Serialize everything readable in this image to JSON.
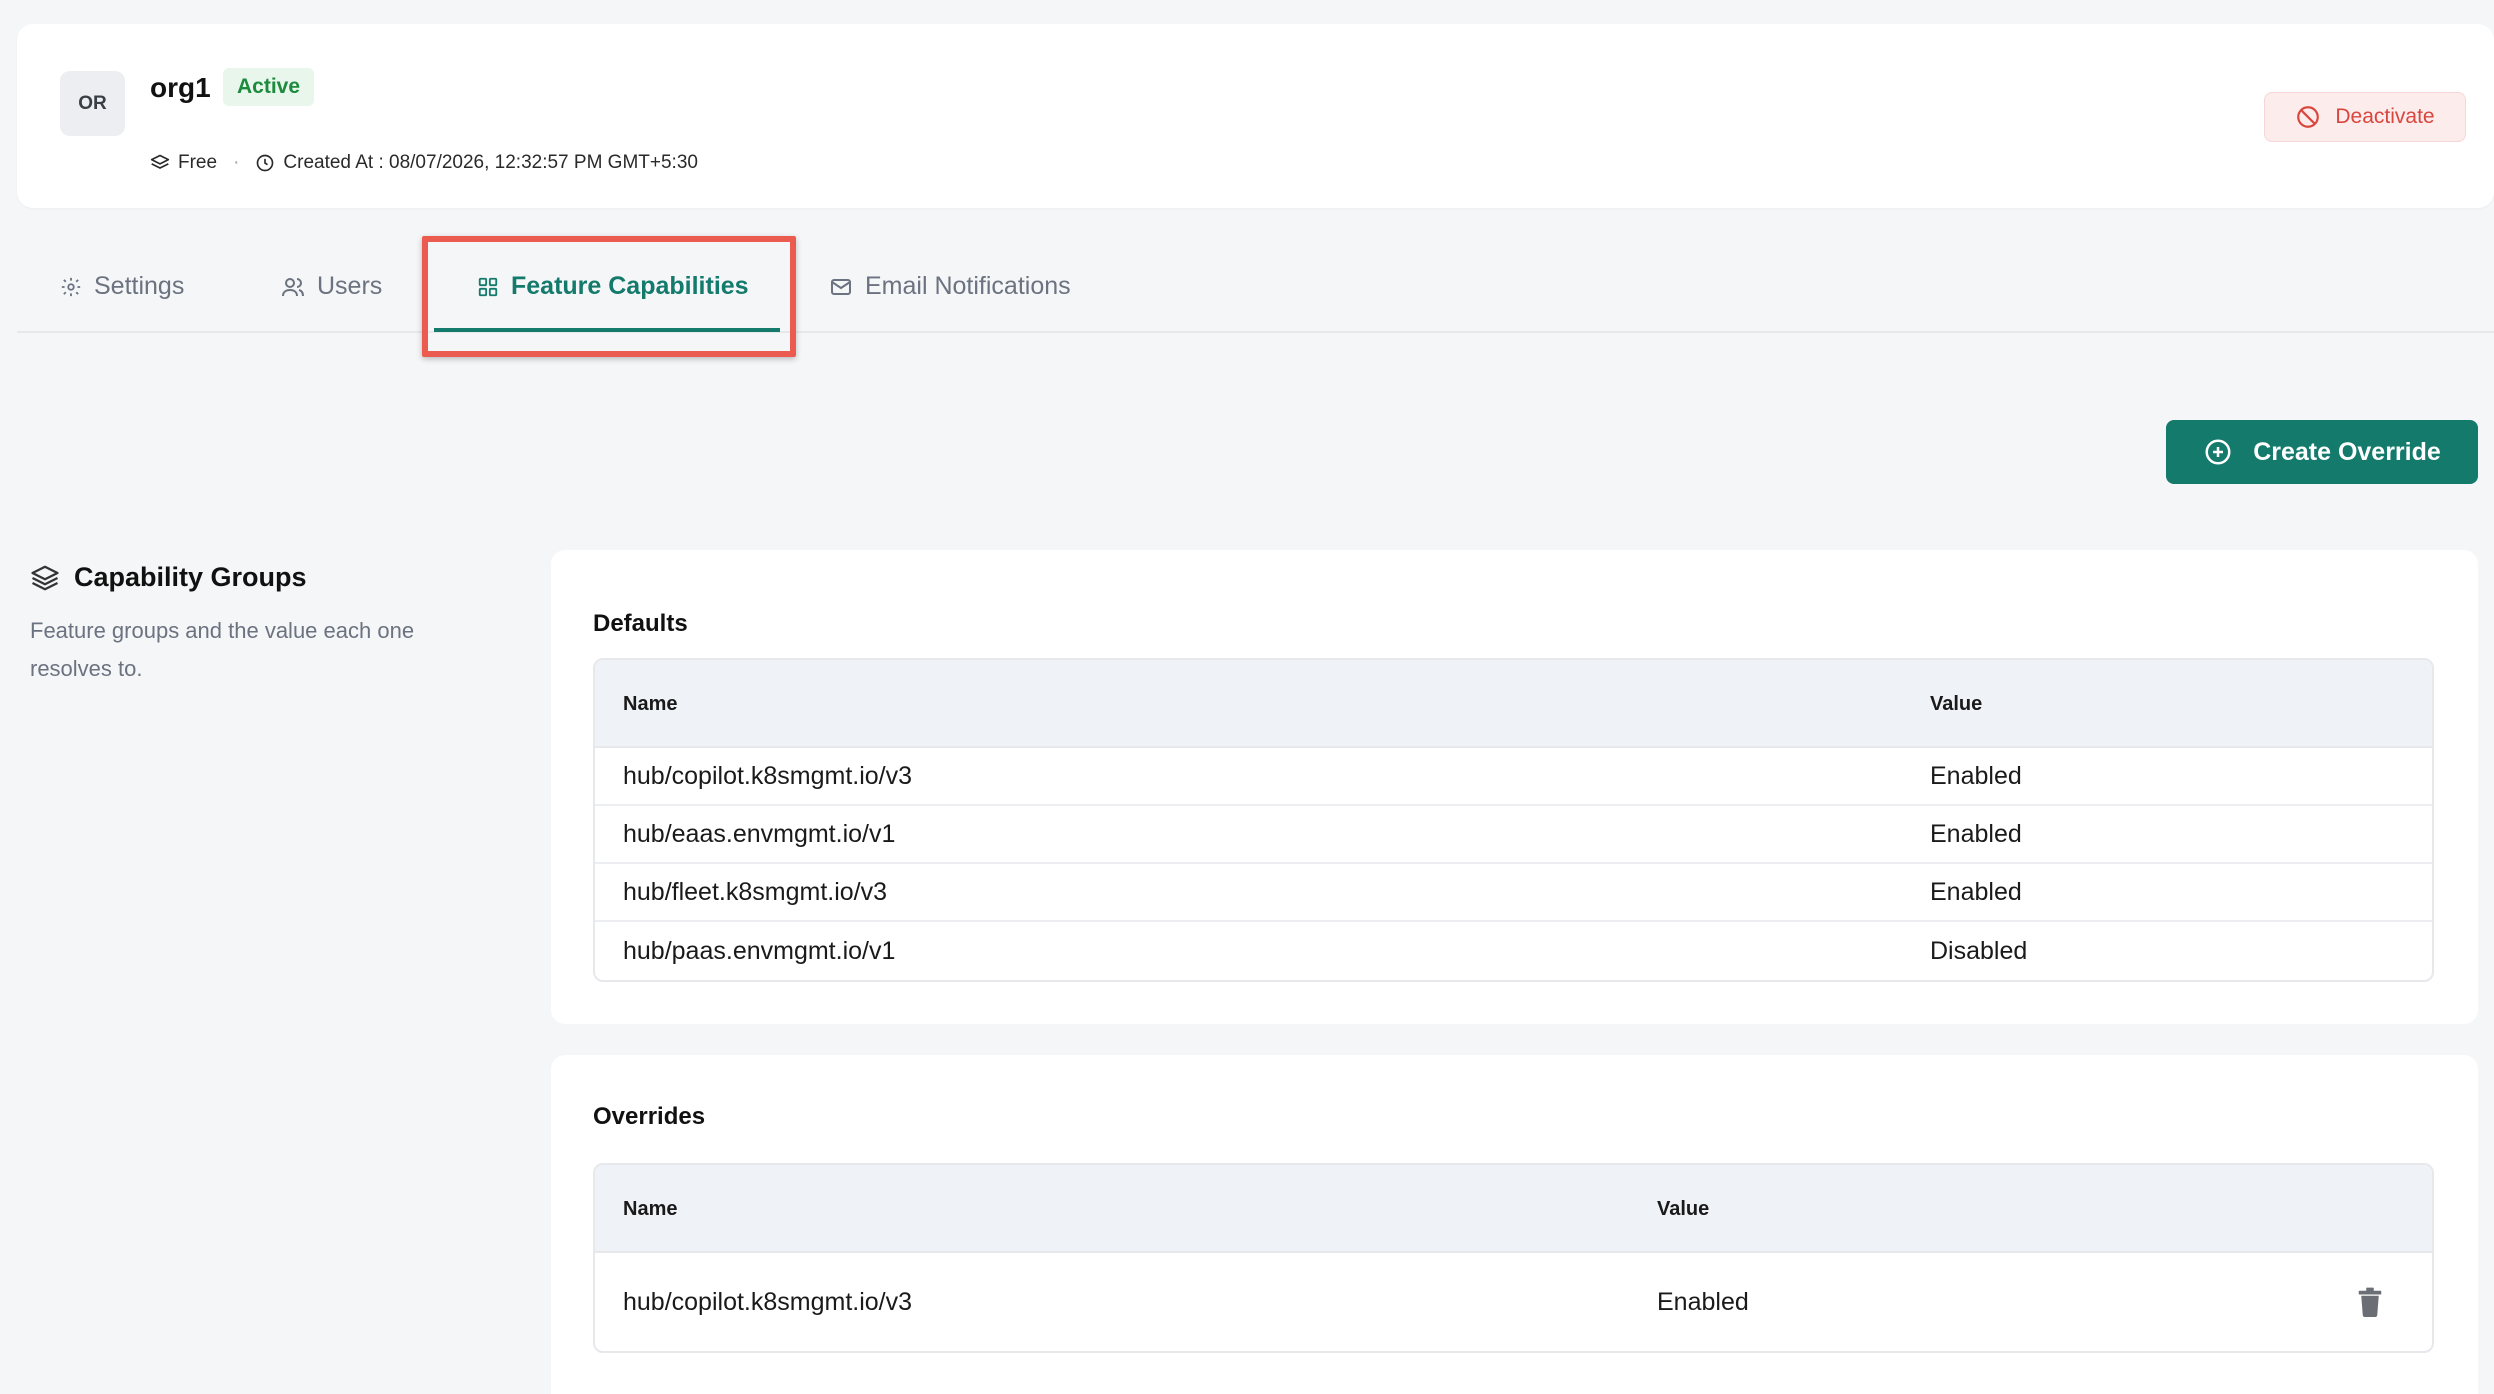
{
  "org": {
    "avatar_initials": "OR",
    "name": "org1",
    "status": "Active",
    "plan": "Free",
    "created_at": "Created At : 08/07/2026, 12:32:57 PM GMT+5:30",
    "deactivate_label": "Deactivate"
  },
  "tabs": [
    {
      "label": "Settings",
      "icon": "gear-icon",
      "active": false
    },
    {
      "label": "Users",
      "icon": "users-icon",
      "active": false
    },
    {
      "label": "Feature Capabilities",
      "icon": "grid-icon",
      "active": true
    },
    {
      "label": "Email Notifications",
      "icon": "mail-icon",
      "active": false
    }
  ],
  "create_override_label": "Create Override",
  "capability_groups": {
    "title": "Capability Groups",
    "description": "Feature groups and the value each one resolves to."
  },
  "defaults": {
    "title": "Defaults",
    "columns": {
      "name": "Name",
      "value": "Value"
    },
    "rows": [
      {
        "name": "hub/copilot.k8smgmt.io/v3",
        "value": "Enabled"
      },
      {
        "name": "hub/eaas.envmgmt.io/v1",
        "value": "Enabled"
      },
      {
        "name": "hub/fleet.k8smgmt.io/v3",
        "value": "Enabled"
      },
      {
        "name": "hub/paas.envmgmt.io/v1",
        "value": "Disabled"
      }
    ]
  },
  "overrides": {
    "title": "Overrides",
    "columns": {
      "name": "Name",
      "value": "Value"
    },
    "rows": [
      {
        "name": "hub/copilot.k8smgmt.io/v3",
        "value": "Enabled"
      }
    ]
  },
  "colors": {
    "accent": "#137a6c",
    "active_badge_bg": "#e8f6ec",
    "active_badge_text": "#1d8a3e",
    "deactivate_text": "#d9463d",
    "highlight_box": "#ec5b50"
  }
}
